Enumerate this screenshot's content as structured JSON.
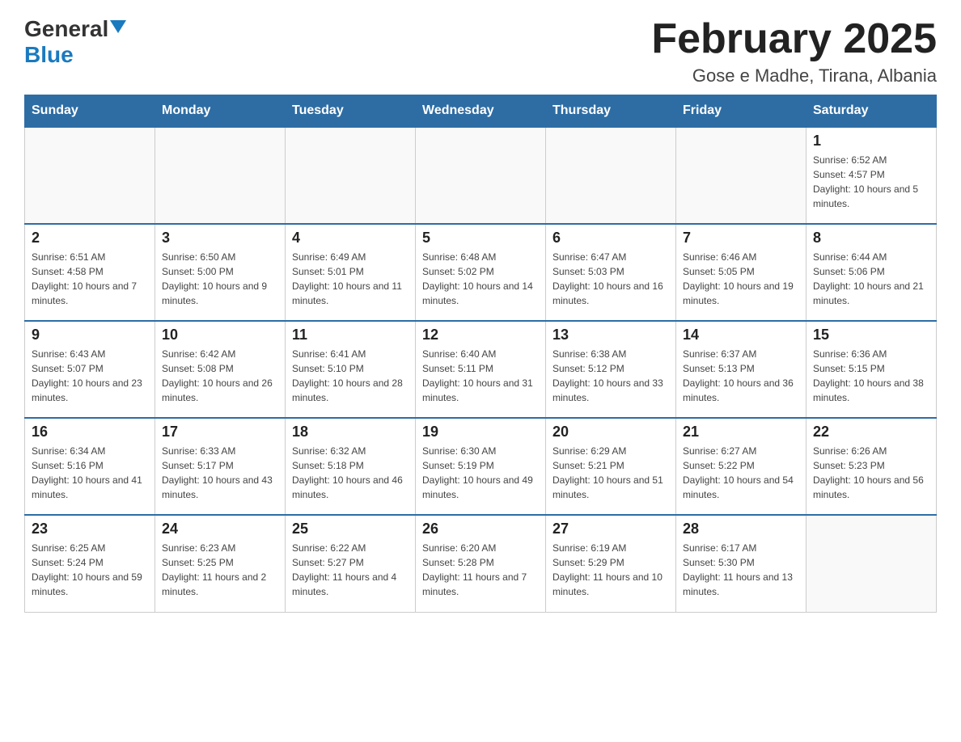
{
  "logo": {
    "general": "General",
    "blue": "Blue",
    "arrow": "▼"
  },
  "title": "February 2025",
  "subtitle": "Gose e Madhe, Tirana, Albania",
  "weekdays": [
    "Sunday",
    "Monday",
    "Tuesday",
    "Wednesday",
    "Thursday",
    "Friday",
    "Saturday"
  ],
  "weeks": [
    [
      {
        "day": "",
        "sunrise": "",
        "sunset": "",
        "daylight": ""
      },
      {
        "day": "",
        "sunrise": "",
        "sunset": "",
        "daylight": ""
      },
      {
        "day": "",
        "sunrise": "",
        "sunset": "",
        "daylight": ""
      },
      {
        "day": "",
        "sunrise": "",
        "sunset": "",
        "daylight": ""
      },
      {
        "day": "",
        "sunrise": "",
        "sunset": "",
        "daylight": ""
      },
      {
        "day": "",
        "sunrise": "",
        "sunset": "",
        "daylight": ""
      },
      {
        "day": "1",
        "sunrise": "Sunrise: 6:52 AM",
        "sunset": "Sunset: 4:57 PM",
        "daylight": "Daylight: 10 hours and 5 minutes."
      }
    ],
    [
      {
        "day": "2",
        "sunrise": "Sunrise: 6:51 AM",
        "sunset": "Sunset: 4:58 PM",
        "daylight": "Daylight: 10 hours and 7 minutes."
      },
      {
        "day": "3",
        "sunrise": "Sunrise: 6:50 AM",
        "sunset": "Sunset: 5:00 PM",
        "daylight": "Daylight: 10 hours and 9 minutes."
      },
      {
        "day": "4",
        "sunrise": "Sunrise: 6:49 AM",
        "sunset": "Sunset: 5:01 PM",
        "daylight": "Daylight: 10 hours and 11 minutes."
      },
      {
        "day": "5",
        "sunrise": "Sunrise: 6:48 AM",
        "sunset": "Sunset: 5:02 PM",
        "daylight": "Daylight: 10 hours and 14 minutes."
      },
      {
        "day": "6",
        "sunrise": "Sunrise: 6:47 AM",
        "sunset": "Sunset: 5:03 PM",
        "daylight": "Daylight: 10 hours and 16 minutes."
      },
      {
        "day": "7",
        "sunrise": "Sunrise: 6:46 AM",
        "sunset": "Sunset: 5:05 PM",
        "daylight": "Daylight: 10 hours and 19 minutes."
      },
      {
        "day": "8",
        "sunrise": "Sunrise: 6:44 AM",
        "sunset": "Sunset: 5:06 PM",
        "daylight": "Daylight: 10 hours and 21 minutes."
      }
    ],
    [
      {
        "day": "9",
        "sunrise": "Sunrise: 6:43 AM",
        "sunset": "Sunset: 5:07 PM",
        "daylight": "Daylight: 10 hours and 23 minutes."
      },
      {
        "day": "10",
        "sunrise": "Sunrise: 6:42 AM",
        "sunset": "Sunset: 5:08 PM",
        "daylight": "Daylight: 10 hours and 26 minutes."
      },
      {
        "day": "11",
        "sunrise": "Sunrise: 6:41 AM",
        "sunset": "Sunset: 5:10 PM",
        "daylight": "Daylight: 10 hours and 28 minutes."
      },
      {
        "day": "12",
        "sunrise": "Sunrise: 6:40 AM",
        "sunset": "Sunset: 5:11 PM",
        "daylight": "Daylight: 10 hours and 31 minutes."
      },
      {
        "day": "13",
        "sunrise": "Sunrise: 6:38 AM",
        "sunset": "Sunset: 5:12 PM",
        "daylight": "Daylight: 10 hours and 33 minutes."
      },
      {
        "day": "14",
        "sunrise": "Sunrise: 6:37 AM",
        "sunset": "Sunset: 5:13 PM",
        "daylight": "Daylight: 10 hours and 36 minutes."
      },
      {
        "day": "15",
        "sunrise": "Sunrise: 6:36 AM",
        "sunset": "Sunset: 5:15 PM",
        "daylight": "Daylight: 10 hours and 38 minutes."
      }
    ],
    [
      {
        "day": "16",
        "sunrise": "Sunrise: 6:34 AM",
        "sunset": "Sunset: 5:16 PM",
        "daylight": "Daylight: 10 hours and 41 minutes."
      },
      {
        "day": "17",
        "sunrise": "Sunrise: 6:33 AM",
        "sunset": "Sunset: 5:17 PM",
        "daylight": "Daylight: 10 hours and 43 minutes."
      },
      {
        "day": "18",
        "sunrise": "Sunrise: 6:32 AM",
        "sunset": "Sunset: 5:18 PM",
        "daylight": "Daylight: 10 hours and 46 minutes."
      },
      {
        "day": "19",
        "sunrise": "Sunrise: 6:30 AM",
        "sunset": "Sunset: 5:19 PM",
        "daylight": "Daylight: 10 hours and 49 minutes."
      },
      {
        "day": "20",
        "sunrise": "Sunrise: 6:29 AM",
        "sunset": "Sunset: 5:21 PM",
        "daylight": "Daylight: 10 hours and 51 minutes."
      },
      {
        "day": "21",
        "sunrise": "Sunrise: 6:27 AM",
        "sunset": "Sunset: 5:22 PM",
        "daylight": "Daylight: 10 hours and 54 minutes."
      },
      {
        "day": "22",
        "sunrise": "Sunrise: 6:26 AM",
        "sunset": "Sunset: 5:23 PM",
        "daylight": "Daylight: 10 hours and 56 minutes."
      }
    ],
    [
      {
        "day": "23",
        "sunrise": "Sunrise: 6:25 AM",
        "sunset": "Sunset: 5:24 PM",
        "daylight": "Daylight: 10 hours and 59 minutes."
      },
      {
        "day": "24",
        "sunrise": "Sunrise: 6:23 AM",
        "sunset": "Sunset: 5:25 PM",
        "daylight": "Daylight: 11 hours and 2 minutes."
      },
      {
        "day": "25",
        "sunrise": "Sunrise: 6:22 AM",
        "sunset": "Sunset: 5:27 PM",
        "daylight": "Daylight: 11 hours and 4 minutes."
      },
      {
        "day": "26",
        "sunrise": "Sunrise: 6:20 AM",
        "sunset": "Sunset: 5:28 PM",
        "daylight": "Daylight: 11 hours and 7 minutes."
      },
      {
        "day": "27",
        "sunrise": "Sunrise: 6:19 AM",
        "sunset": "Sunset: 5:29 PM",
        "daylight": "Daylight: 11 hours and 10 minutes."
      },
      {
        "day": "28",
        "sunrise": "Sunrise: 6:17 AM",
        "sunset": "Sunset: 5:30 PM",
        "daylight": "Daylight: 11 hours and 13 minutes."
      },
      {
        "day": "",
        "sunrise": "",
        "sunset": "",
        "daylight": ""
      }
    ]
  ]
}
